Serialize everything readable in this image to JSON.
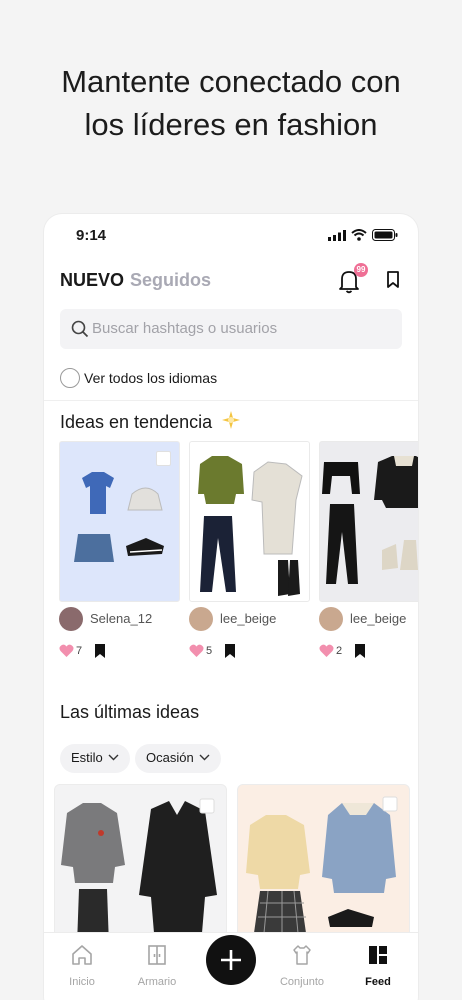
{
  "headline": {
    "line1": "Mantente conectado con",
    "line2": "los líderes en fashion"
  },
  "status_bar": {
    "time": "9:14"
  },
  "header": {
    "tab_new": "NUEVO",
    "tab_following": "Seguidos",
    "notification_count": "99",
    "accent_color": "#ef6f95"
  },
  "search": {
    "placeholder": "Buscar hashtags o usuarios"
  },
  "language_toggle": {
    "label": "Ver todos los idiomas"
  },
  "trending": {
    "title": "Ideas en tendencia",
    "cards": [
      {
        "username": "Selena_12",
        "likes": "7",
        "background": "#dde6fb"
      },
      {
        "username": "lee_beige",
        "likes": "5",
        "background": "#ffffff"
      },
      {
        "username": "lee_beige",
        "likes": "2",
        "background": "#ececef"
      }
    ]
  },
  "latest": {
    "title": "Las últimas ideas",
    "filters": [
      "Estilo",
      "Ocasión"
    ]
  },
  "tabbar": {
    "items": [
      {
        "label": "Inicio",
        "icon": "home-icon"
      },
      {
        "label": "Armario",
        "icon": "wardrobe-icon"
      },
      {
        "label": "",
        "icon": "plus-icon"
      },
      {
        "label": "Conjunto",
        "icon": "outfit-icon"
      },
      {
        "label": "Feed",
        "icon": "feed-icon"
      }
    ],
    "active": "Feed"
  }
}
